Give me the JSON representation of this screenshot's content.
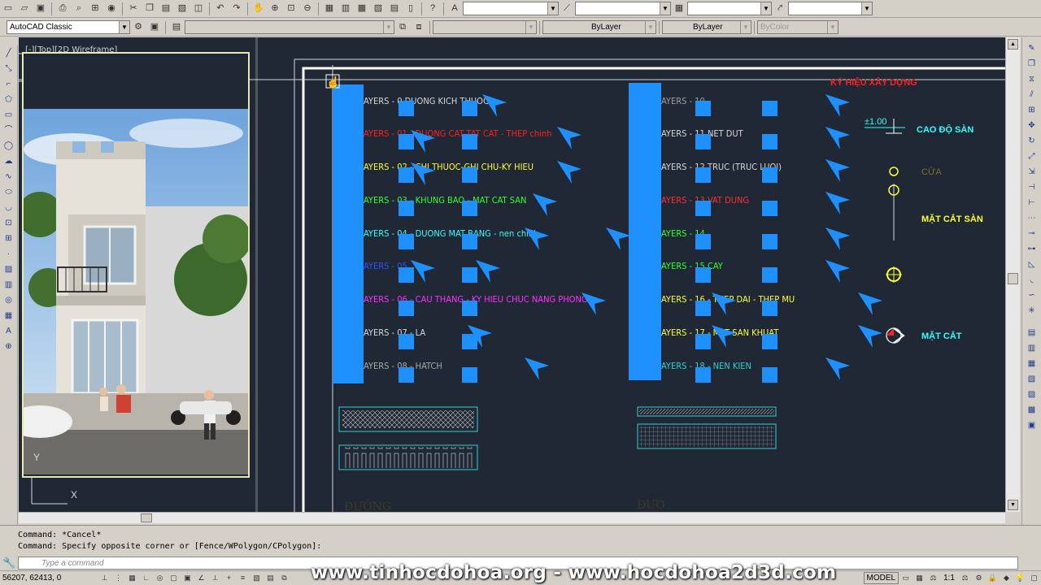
{
  "toolbar_top": {
    "dropdowns": [
      "",
      "",
      "",
      ""
    ]
  },
  "toolbar_workspace": {
    "workspace": "AutoCAD Classic",
    "layer": "",
    "color": "",
    "linetype": "ByLayer",
    "lineweight": "ByLayer",
    "plotstyle": "ByColor"
  },
  "viewport": {
    "label": "[-][Top][2D Wireframe]"
  },
  "ucs": {
    "y": "Y",
    "x": "X"
  },
  "layers_left": [
    {
      "label": "AYERS - 0 DUONG KICH THUOC",
      "color": "#d8d8d8"
    },
    {
      "label": "AYERS - 01 - DUONG CAT TAT CAT - THEP chinh",
      "color": "#ff2020"
    },
    {
      "label": "AYERS - 02 - CHI THUOC-GHI CHU-KY HIEU",
      "color": "#ffff30"
    },
    {
      "label": "AYERS - 03 - KHUNG BAO - MAT CAT SAN",
      "color": "#30ff30"
    },
    {
      "label": "AYERS - 04 - DUONG MAT BANG - nen chinh",
      "color": "#30ffff"
    },
    {
      "label": "AYERS - 05",
      "color": "#3050ff"
    },
    {
      "label": "AYERS - 06 - CAU THANG - KY HIEU CHUC NANG PHONG",
      "color": "#ff30ff"
    },
    {
      "label": "AYERS - 07 - LA",
      "color": "#d8d8d8"
    },
    {
      "label": "AYERS - 08 - HATCH",
      "color": "#a8a8a8"
    }
  ],
  "layers_right": [
    {
      "label": "AYERS - 10",
      "color": "#a0a0a0"
    },
    {
      "label": "AYERS - 11 NET DUT",
      "color": "#d8d8d8"
    },
    {
      "label": "AYERS - 12 TRUC (TRUC LUOI)",
      "color": "#d8d8d8"
    },
    {
      "label": "AYERS - 13 VAT DUNG",
      "color": "#ff3030"
    },
    {
      "label": "AYERS - 14",
      "color": "#30ff30"
    },
    {
      "label": "AYERS - 15 CAY",
      "color": "#30ff30"
    },
    {
      "label": "AYERS - 16 - THEP DAI - THEP MU",
      "color": "#ffff30"
    },
    {
      "label": "AYERS - 17 - MAT SAN KHUAT",
      "color": "#ffff30"
    },
    {
      "label": "AYERS - 18 - NEN KIEN",
      "color": "#30d0d0"
    }
  ],
  "symbols": {
    "title": "KÝ HIỆU XÂY DỰNG",
    "level_value": "±1.00",
    "cao_do_san": "CAO ĐỘ SÀN",
    "cua": "CỬA",
    "mat_cat_san": "MẶT CẮT SÀN",
    "mat_cat": "MẶT CẮT"
  },
  "command": {
    "line1": "Command: *Cancel*",
    "line2": "Command: Specify opposite corner or [Fence/WPolygon/CPolygon]:",
    "placeholder": "Type a command"
  },
  "status": {
    "coords": "56207, 62413, 0",
    "model": "MODEL",
    "scale": "1:1"
  },
  "watermark": "www.tinhocdohoa.org - www.hocdohoa2d3d.com",
  "colors": {
    "canvas_bg": "#1f2834",
    "grip_blue": "#1e90ff",
    "chrome": "#d4d0c8"
  }
}
